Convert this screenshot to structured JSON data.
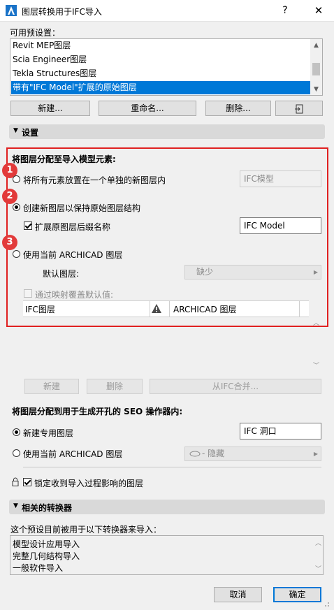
{
  "window": {
    "title": "图层转换用于IFC导入",
    "help": "?",
    "close": "✕"
  },
  "presets": {
    "label": "可用预设置：",
    "items": [
      "Revit MEP图层",
      "Scia Engineer图层",
      "Tekla Structures图层",
      "带有\"IFC Model\"扩展的原始图层"
    ],
    "selected_index": 3,
    "buttons": {
      "new": "新建...",
      "rename": "重命名...",
      "delete": "删除..."
    }
  },
  "settings": {
    "header": "设置",
    "assign_heading": "将图层分配至导入模型元素:",
    "option1": "将所有元素放置在一个单独的新图层内",
    "option1_value": "IFC模型",
    "option2": "创建新图层以保持原始图层结构",
    "option2_check": "扩展原图层后缀名称",
    "option2_value": "IFC Model",
    "option3": "使用当前 ARCHICAD 图层",
    "default_layer_label": "默认图层:",
    "default_layer_value": "缺少",
    "override_label": "通过映射覆盖默认值:",
    "table_col1": "IFC图层",
    "table_col2": "ARCHICAD 图层",
    "markers": [
      "1",
      "2",
      "3"
    ],
    "selected_option": 2
  },
  "mapping_buttons": {
    "new": "新建",
    "delete": "删除",
    "merge": "从IFC合并..."
  },
  "seo": {
    "heading": "将图层分配到用于生成开孔的 SEO 操作器内:",
    "option1": "新建专用图层",
    "option1_value": "IFC 洞口",
    "option2": "使用当前 ARCHICAD 图层",
    "option2_value": "- 隐藏",
    "lock_label": "锁定收到导入过程影响的图层"
  },
  "related": {
    "header": "相关的转换器",
    "description": "这个预设目前被用于以下转换器来导入：",
    "items": [
      "模型设计应用导入",
      "完整几何结构导入",
      "一般软件导入"
    ]
  },
  "footer": {
    "cancel": "取消",
    "ok": "确定"
  },
  "colors": {
    "selection": "#0078d7",
    "highlight_box": "#e02020",
    "marker": "#e23a3a"
  }
}
